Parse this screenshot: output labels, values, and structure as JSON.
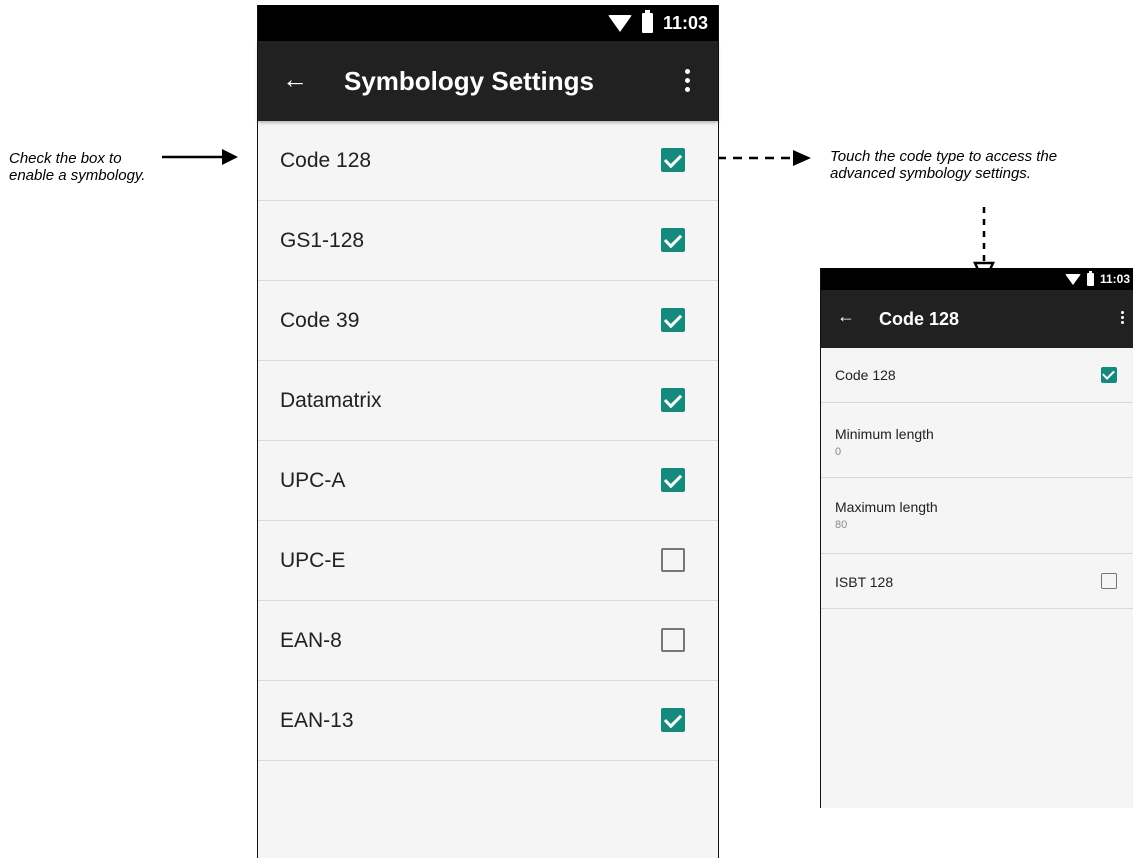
{
  "callouts": {
    "left_line1": "Check the box to",
    "left_line2": "enable a symbology.",
    "right_line1": "Touch the code type to access the",
    "right_line2": "advanced symbology settings."
  },
  "main_screen": {
    "status_time": "11:03",
    "title": "Symbology Settings",
    "rows": [
      {
        "label": "Code 128",
        "checked": true
      },
      {
        "label": "GS1-128",
        "checked": true
      },
      {
        "label": "Code 39",
        "checked": true
      },
      {
        "label": "Datamatrix",
        "checked": true
      },
      {
        "label": "UPC-A",
        "checked": true
      },
      {
        "label": "UPC-E",
        "checked": false
      },
      {
        "label": "EAN-8",
        "checked": false
      },
      {
        "label": "EAN-13",
        "checked": true
      }
    ]
  },
  "detail_screen": {
    "status_time": "11:03",
    "title": "Code 128",
    "rows": [
      {
        "label": "Code 128",
        "checked": true
      },
      {
        "label": "Minimum length",
        "value": "0"
      },
      {
        "label": "Maximum length",
        "value": "80"
      },
      {
        "label": "ISBT 128",
        "checked": false
      }
    ]
  },
  "colors": {
    "checkbox_on": "#14897d",
    "app_bar": "#212121",
    "status_bar": "#000000"
  }
}
